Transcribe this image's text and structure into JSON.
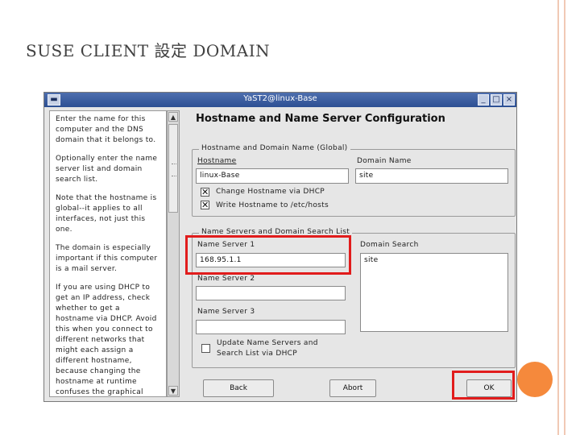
{
  "slide": {
    "title": "SUSE CLIENT 設定 DOMAIN",
    "accent_color": "#f5893c",
    "highlight_color": "#e11c1c"
  },
  "window": {
    "title": "YaST2@linux-Base",
    "menu_icon": "menu-icon",
    "minimize_icon": "minimize-icon",
    "maximize_icon": "maximize-icon",
    "close_icon": "close-icon"
  },
  "help": {
    "paragraphs": [
      "Enter the name for this computer and the DNS domain that it belongs to.",
      "Optionally enter the name server list and domain search list.",
      "Note that the hostname is global--it applies to all interfaces, not just this one.",
      "The domain is especially important if this computer is a mail server.",
      "If you are using DHCP to get an IP address, check whether to get a hostname via DHCP. Avoid this when you connect to different networks that might each assign a different hostname, because changing the hostname at runtime confuses the graphical desktop."
    ]
  },
  "main": {
    "heading": "Hostname and Name Server Configuration",
    "hostname_group": {
      "legend": "Hostname and Domain Name (Global)",
      "hostname_label": "Hostname",
      "hostname_value": "linux-Base",
      "domain_label": "Domain Name",
      "domain_value": "site",
      "change_hostname_dhcp": {
        "label": "Change Hostname via DHCP",
        "checked": true
      },
      "write_hostname": {
        "label": "Write Hostname to /etc/hosts",
        "checked": true
      }
    },
    "nameserver_group": {
      "legend": "Name Servers and Domain Search List",
      "ns1_label": "Name Server 1",
      "ns1_value": "168.95.1.1",
      "ns2_label": "Name Server 2",
      "ns2_value": "",
      "ns3_label": "Name Server 3",
      "ns3_value": "",
      "domain_search_label": "Domain Search",
      "domain_search_value": "site",
      "update_ns": {
        "label_line1": "Update Name Servers and",
        "label_line2": "Search List via DHCP",
        "checked": false
      }
    }
  },
  "buttons": {
    "back": "Back",
    "abort": "Abort",
    "ok": "OK"
  }
}
